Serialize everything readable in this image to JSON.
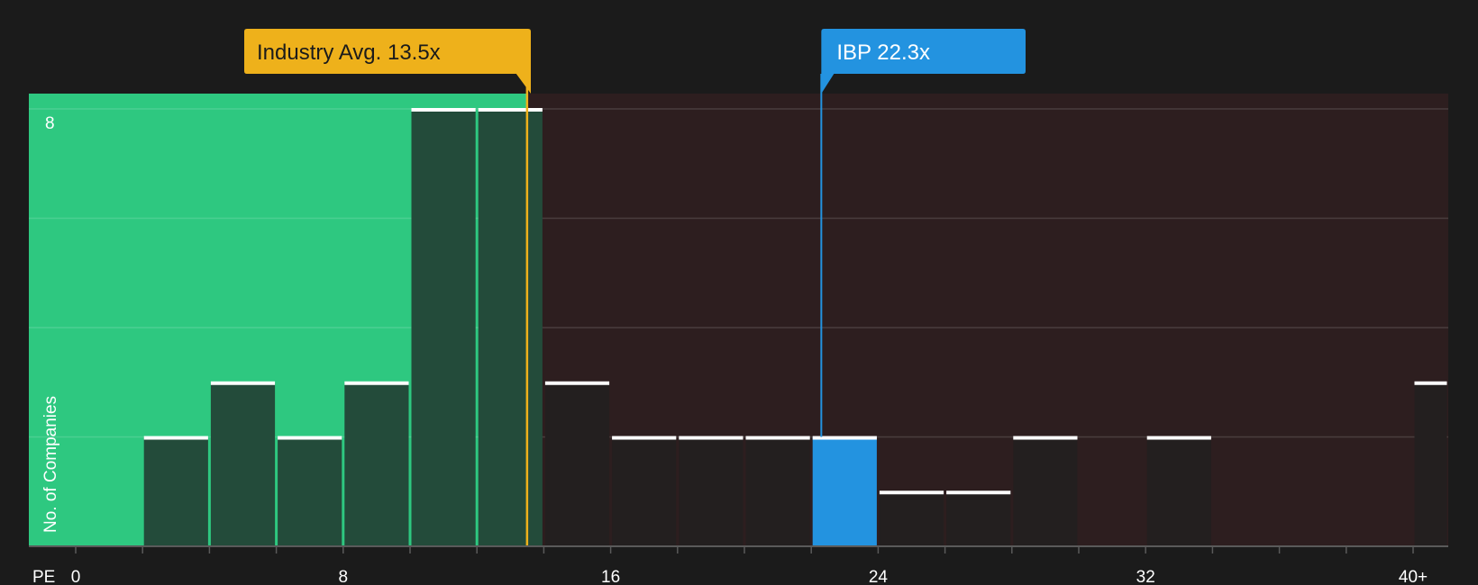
{
  "chart_data": {
    "type": "bar",
    "title": "",
    "xlabel": "PE",
    "ylabel": "No. of Companies",
    "xlim": [
      0,
      41.3
    ],
    "ylim": [
      0,
      8
    ],
    "x_ticks": [
      0,
      8,
      16,
      24,
      32,
      40
    ],
    "x_tick_labels": [
      "0",
      "8",
      "16",
      "24",
      "32",
      "40+"
    ],
    "y_ticks": [
      8
    ],
    "y_tick_labels": [
      "8"
    ],
    "bin_width": 2,
    "bins": [
      {
        "start": 2,
        "end": 4,
        "value": 2
      },
      {
        "start": 4,
        "end": 6,
        "value": 3
      },
      {
        "start": 6,
        "end": 8,
        "value": 2
      },
      {
        "start": 8,
        "end": 10,
        "value": 3
      },
      {
        "start": 10,
        "end": 12,
        "value": 8
      },
      {
        "start": 12,
        "end": 14,
        "value": 8
      },
      {
        "start": 14,
        "end": 16,
        "value": 3
      },
      {
        "start": 16,
        "end": 18,
        "value": 2
      },
      {
        "start": 18,
        "end": 20,
        "value": 2
      },
      {
        "start": 20,
        "end": 22,
        "value": 2
      },
      {
        "start": 22,
        "end": 24,
        "value": 2,
        "highlight": true
      },
      {
        "start": 24,
        "end": 26,
        "value": 1
      },
      {
        "start": 26,
        "end": 28,
        "value": 1
      },
      {
        "start": 28,
        "end": 30,
        "value": 2
      },
      {
        "start": 30,
        "end": 32,
        "value": 0
      },
      {
        "start": 32,
        "end": 34,
        "value": 2
      },
      {
        "start": 34,
        "end": 36,
        "value": 0
      },
      {
        "start": 36,
        "end": 38,
        "value": 0
      },
      {
        "start": 38,
        "end": 40,
        "value": 0
      },
      {
        "start": 40,
        "end": 41.3,
        "value": 3
      }
    ],
    "industry_avg": {
      "label": "Industry Avg. 13.5x",
      "value": 13.5
    },
    "company": {
      "label": "IBP 22.3x",
      "value": 22.3
    },
    "grid": true,
    "colors": {
      "background": "#1b1b1b",
      "below_avg_zone": "#2ec880",
      "above_avg_zone": "#2d1e1f",
      "bar_in_green": "#234b3a",
      "bar_in_red": "#231f1f",
      "bar_top": "#ffffff",
      "highlight_bar": "#2393e0",
      "industry_marker": "#eeb11b",
      "company_marker": "#2393e0"
    }
  }
}
